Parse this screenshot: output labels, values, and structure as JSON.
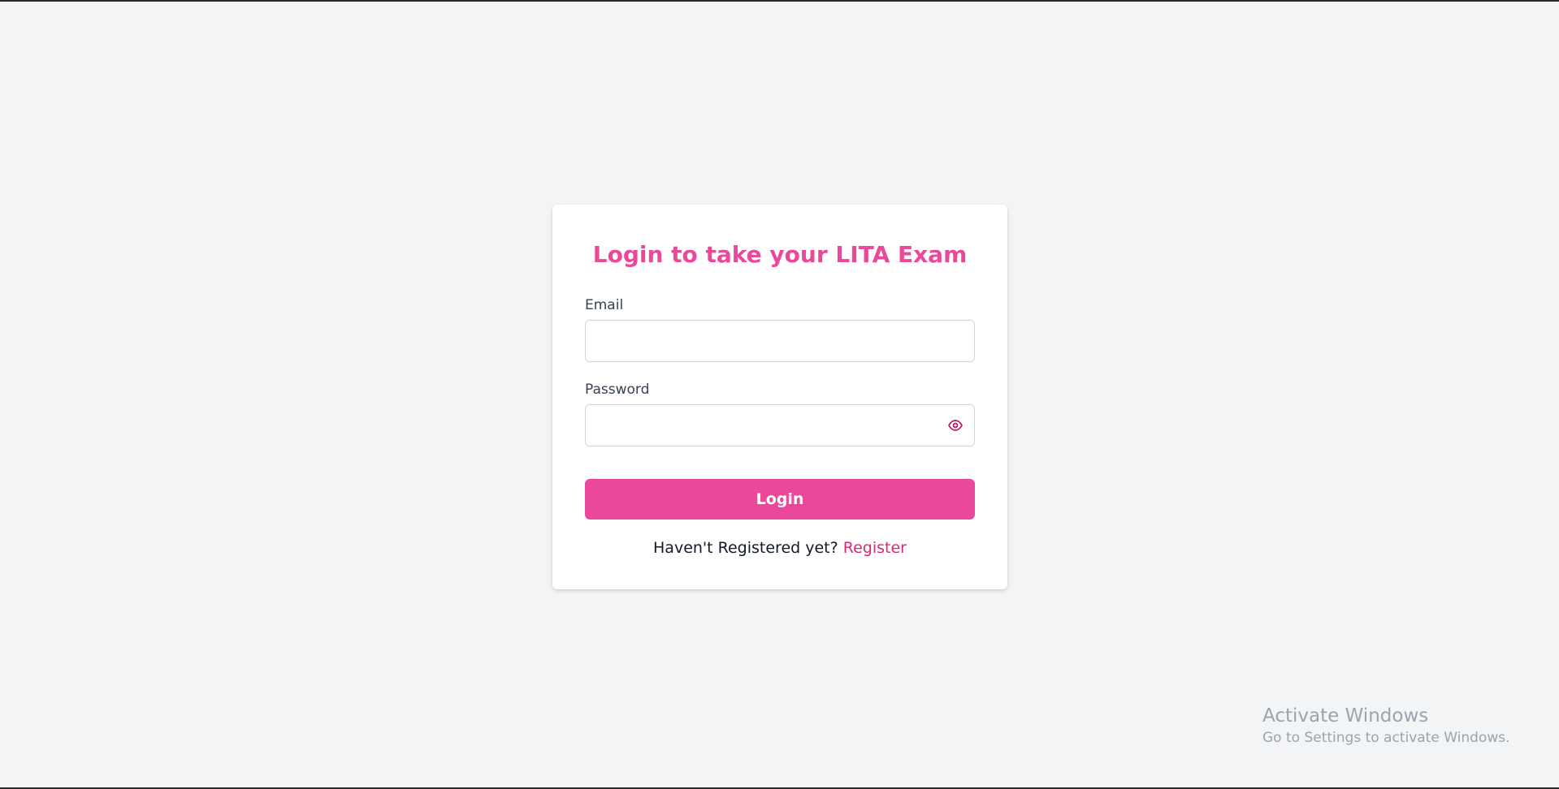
{
  "colors": {
    "background": "#f3f4f6",
    "accent": "#ec4899",
    "link": "#db2777",
    "label": "#374151",
    "watermark": "#9ca3af"
  },
  "login_form": {
    "title": "Login to take your LITA Exam",
    "email": {
      "label": "Email",
      "value": "",
      "placeholder": ""
    },
    "password": {
      "label": "Password",
      "value": "",
      "placeholder": "",
      "toggle_icon": "eye-icon"
    },
    "submit_label": "Login",
    "register_prompt": "Haven't Registered yet?",
    "register_link": "Register"
  },
  "windows_watermark": {
    "title": "Activate Windows",
    "subtitle": "Go to Settings to activate Windows."
  }
}
